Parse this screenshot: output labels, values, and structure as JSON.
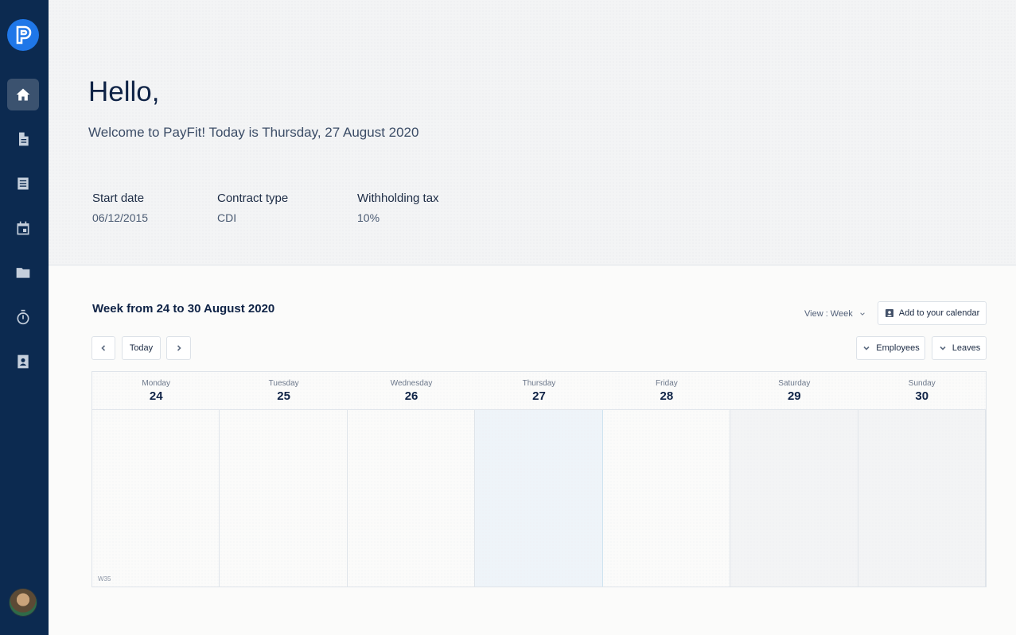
{
  "header": {
    "greeting": "Hello,",
    "welcome": "Welcome to PayFit! Today is Thursday, 27 August 2020",
    "info": [
      {
        "label": "Start date",
        "value": "06/12/2015"
      },
      {
        "label": "Contract type",
        "value": "CDI"
      },
      {
        "label": "Withholding tax",
        "value": "10%"
      }
    ]
  },
  "sidebar": {
    "logo_icon": "payfit-logo-icon",
    "items": [
      {
        "icon": "home-icon",
        "active": true
      },
      {
        "icon": "document-icon",
        "active": false
      },
      {
        "icon": "payslip-icon",
        "active": false
      },
      {
        "icon": "calendar-icon",
        "active": false
      },
      {
        "icon": "folder-icon",
        "active": false
      },
      {
        "icon": "timer-icon",
        "active": false
      },
      {
        "icon": "contacts-icon",
        "active": false
      }
    ]
  },
  "calendar": {
    "title": "Week from 24 to 30 August 2020",
    "view_label": "View : Week",
    "add_to_calendar": "Add to your calendar",
    "today_label": "Today",
    "employees_label": "Employees",
    "leaves_label": "Leaves",
    "week_number": "W35",
    "days": [
      {
        "name": "Monday",
        "num": "24"
      },
      {
        "name": "Tuesday",
        "num": "25"
      },
      {
        "name": "Wednesday",
        "num": "26"
      },
      {
        "name": "Thursday",
        "num": "27"
      },
      {
        "name": "Friday",
        "num": "28"
      },
      {
        "name": "Saturday",
        "num": "29"
      },
      {
        "name": "Sunday",
        "num": "30"
      }
    ]
  },
  "colors": {
    "sidebar": "#0c2a50",
    "accent": "#1f77e8",
    "today_column": "#eef4f9"
  }
}
